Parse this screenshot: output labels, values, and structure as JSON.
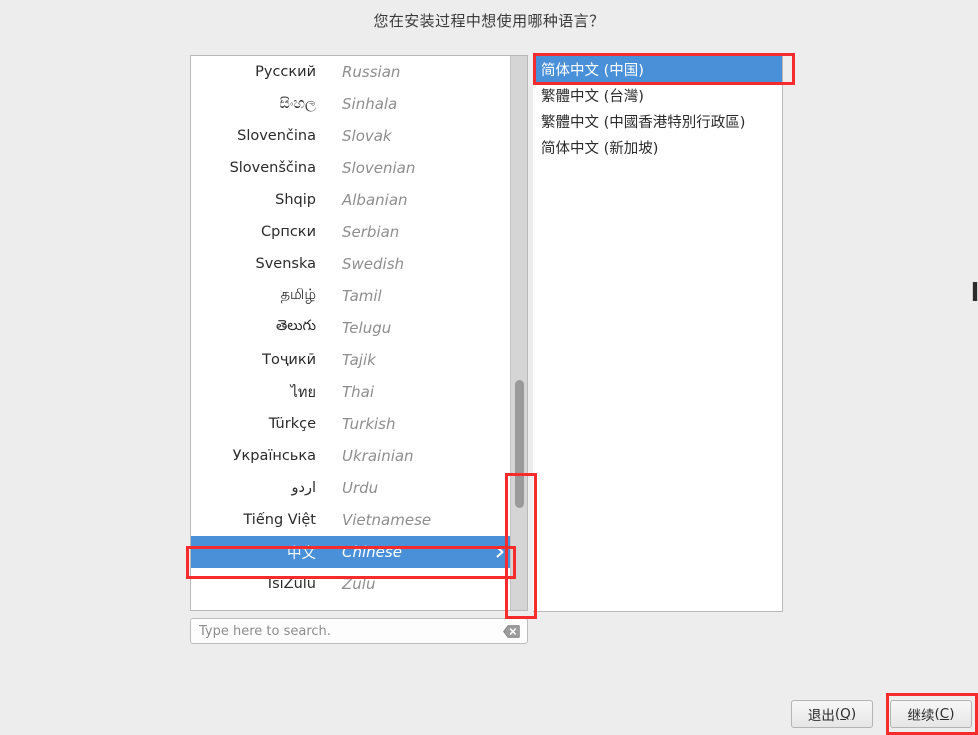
{
  "window": {
    "title": "您在安装过程中想使用哪种语言？",
    "background_color": "#ededed"
  },
  "colors": {
    "selection_blue": "#4a90d9",
    "annotation_red": "#f62b2b",
    "panel_white": "#ffffff",
    "panel_border": "#b9b9b9",
    "english_name_gray": "#8e8e8e"
  },
  "language_list": {
    "items": [
      {
        "native": "Русский",
        "english": "Russian",
        "selected": false
      },
      {
        "native": "සිංහල",
        "english": "Sinhala",
        "selected": false
      },
      {
        "native": "Slovenčina",
        "english": "Slovak",
        "selected": false
      },
      {
        "native": "Slovenščina",
        "english": "Slovenian",
        "selected": false
      },
      {
        "native": "Shqip",
        "english": "Albanian",
        "selected": false
      },
      {
        "native": "Српски",
        "english": "Serbian",
        "selected": false
      },
      {
        "native": "Svenska",
        "english": "Swedish",
        "selected": false
      },
      {
        "native": "தமிழ்",
        "english": "Tamil",
        "selected": false
      },
      {
        "native": "తెలుగు",
        "english": "Telugu",
        "selected": false
      },
      {
        "native": "Тоҷикӣ",
        "english": "Tajik",
        "selected": false
      },
      {
        "native": "ไทย",
        "english": "Thai",
        "selected": false
      },
      {
        "native": "Türkçe",
        "english": "Turkish",
        "selected": false
      },
      {
        "native": "Українська",
        "english": "Ukrainian",
        "selected": false
      },
      {
        "native": "اردو",
        "english": "Urdu",
        "selected": false
      },
      {
        "native": "Tiếng Việt",
        "english": "Vietnamese",
        "selected": false
      },
      {
        "native": "中文",
        "english": "Chinese",
        "selected": true
      },
      {
        "native": "IsiZulu",
        "english": "Zulu",
        "selected": false
      }
    ],
    "scrollbar": {
      "orientation": "vertical",
      "thumb_position_percent": 76
    }
  },
  "search": {
    "value": "",
    "placeholder": "Type here to search.",
    "clear_icon": "backspace-clear-icon"
  },
  "variant_list": {
    "items": [
      {
        "label": "简体中文 (中国)",
        "selected": true
      },
      {
        "label": "繁體中文 (台灣)",
        "selected": false
      },
      {
        "label": "繁體中文 (中國香港特別行政區)",
        "selected": false
      },
      {
        "label": "简体中文 (新加坡)",
        "selected": false
      }
    ]
  },
  "footer": {
    "quit_button": {
      "label": "退出",
      "accelerator": "Q"
    },
    "continue_button": {
      "label": "继续",
      "accelerator": "C"
    }
  },
  "annotations": [
    {
      "name": "chinese-row-highlight",
      "target": "中文 / Chinese list row"
    },
    {
      "name": "scrollbar-highlight",
      "target": "language list vertical scrollbar"
    },
    {
      "name": "variant-selection-highlight",
      "target": "简体中文 (中国)"
    },
    {
      "name": "continue-button-highlight",
      "target": "继续(C)"
    }
  ]
}
